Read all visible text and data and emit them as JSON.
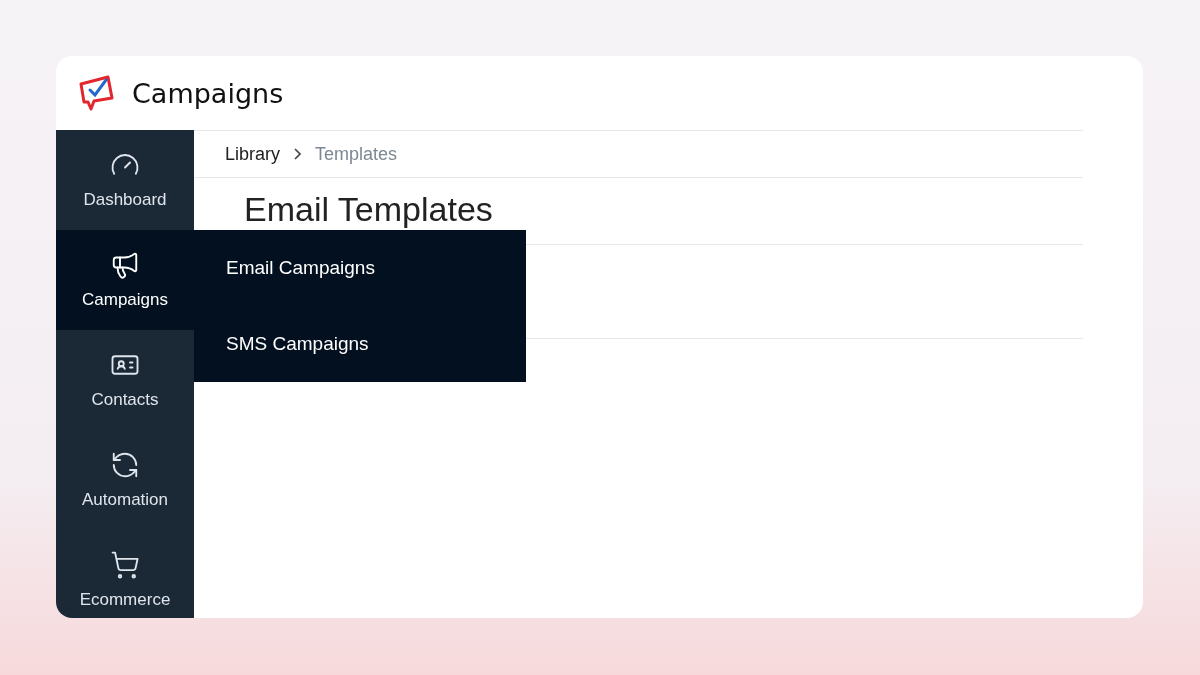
{
  "header": {
    "title": "Campaigns"
  },
  "sidebar": {
    "items": [
      {
        "label": "Dashboard",
        "selected": false
      },
      {
        "label": "Campaigns",
        "selected": true
      },
      {
        "label": "Contacts",
        "selected": false
      },
      {
        "label": "Automation",
        "selected": false
      },
      {
        "label": "Ecommerce",
        "selected": false
      }
    ]
  },
  "breadcrumb": [
    {
      "label": "Library",
      "current": false
    },
    {
      "label": "Templates",
      "current": true
    }
  ],
  "page_title": "Email Templates",
  "flyout_menu": {
    "items": [
      "Email Campaigns",
      "SMS Campaigns"
    ]
  }
}
